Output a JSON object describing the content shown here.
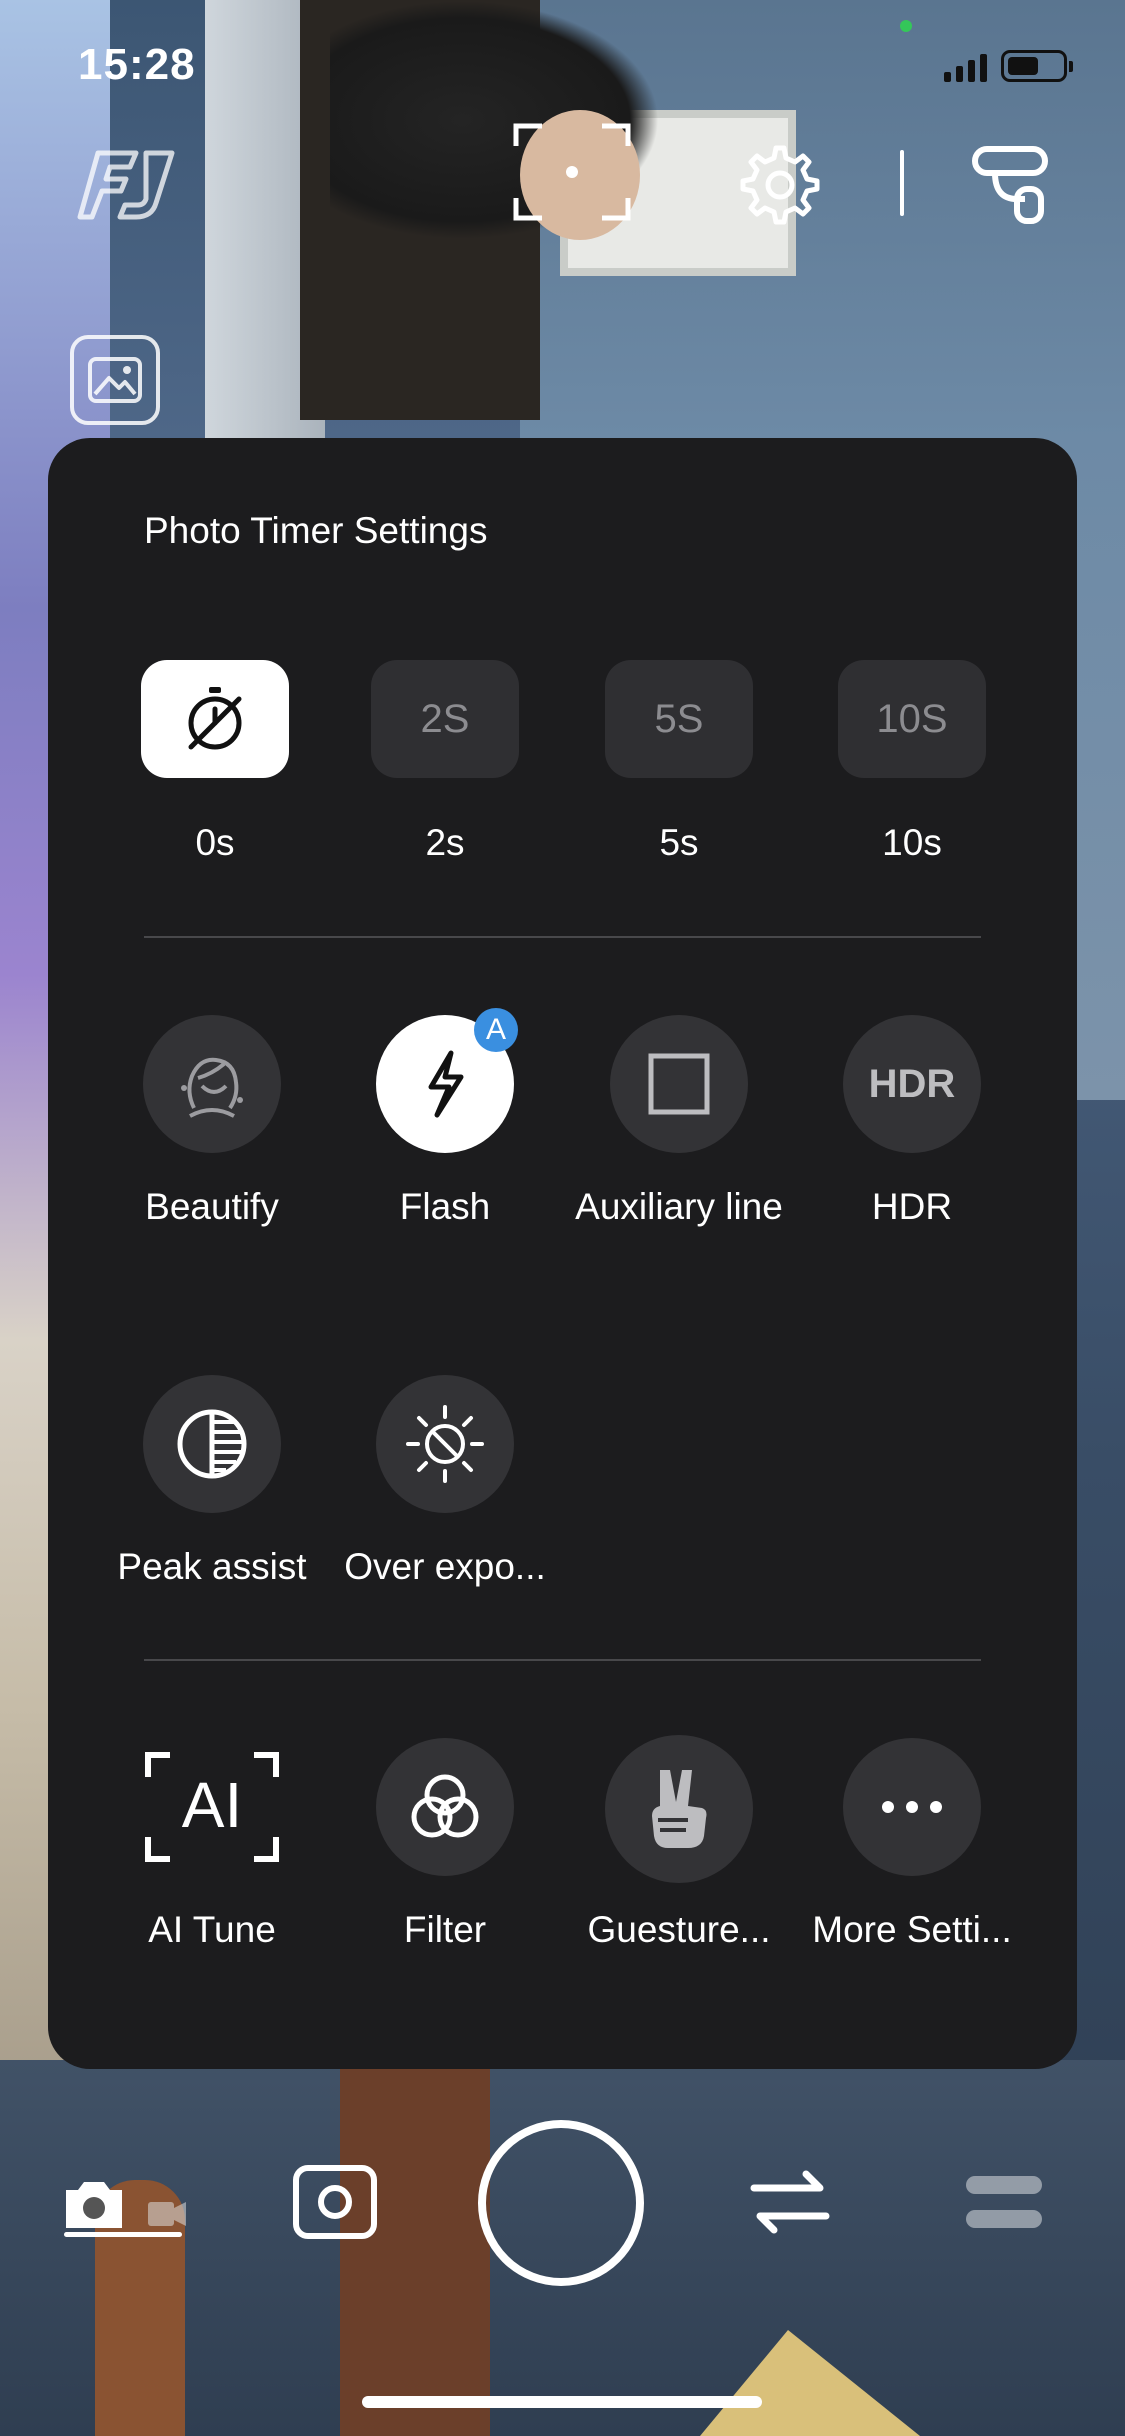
{
  "status_bar": {
    "time": "15:28"
  },
  "panel": {
    "title": "Photo Timer Settings",
    "timer_options": [
      {
        "label": "0s",
        "button_text": "",
        "icon": "timer-off-icon",
        "selected": true
      },
      {
        "label": "2s",
        "button_text": "2S",
        "selected": false
      },
      {
        "label": "5s",
        "button_text": "5S",
        "selected": false
      },
      {
        "label": "10s",
        "button_text": "10S",
        "selected": false
      }
    ],
    "options_row1": [
      {
        "label": "Beautify",
        "icon": "beautify-icon"
      },
      {
        "label": "Flash",
        "icon": "flash-icon",
        "badge": "A",
        "active": true
      },
      {
        "label": "Auxiliary line",
        "icon": "grid-square-icon"
      },
      {
        "label": "HDR",
        "icon_text": "HDR"
      }
    ],
    "options_row2": [
      {
        "label": "Peak assist",
        "icon": "peak-assist-icon"
      },
      {
        "label": "Over expo...",
        "icon": "exposure-off-icon"
      }
    ],
    "options_row3": [
      {
        "label": "AI Tune",
        "icon_text": "AI"
      },
      {
        "label": "Filter",
        "icon": "filter-icon"
      },
      {
        "label": "Guesture...",
        "icon": "gesture-hand-icon"
      },
      {
        "label": "More Setti...",
        "icon": "more-dots-icon"
      }
    ]
  },
  "colors": {
    "panel_bg": "#1c1c1e",
    "button_bg": "#333336",
    "accent_badge": "#3a8fe0"
  }
}
